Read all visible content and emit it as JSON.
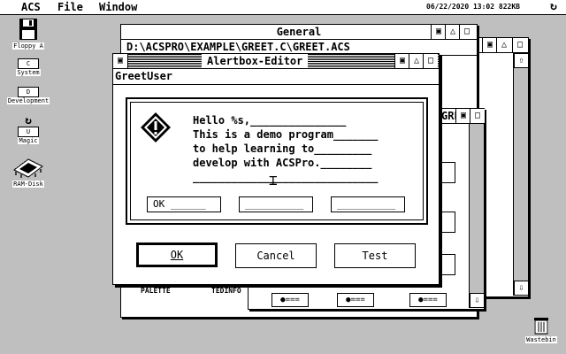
{
  "menubar": {
    "items": [
      "ACS",
      "File",
      "Window"
    ],
    "clock": "06/22/2020 13:02 822KB"
  },
  "desktop": {
    "icons": [
      {
        "name": "floppy-icon",
        "label": "Floppy A"
      },
      {
        "name": "drive-c-icon",
        "label": "System",
        "letter": "C"
      },
      {
        "name": "drive-d-icon",
        "label": "Development",
        "letter": "D"
      },
      {
        "name": "drive-u-icon",
        "label": "Magic",
        "letter": "U"
      },
      {
        "name": "ramdisk-icon",
        "label": "RAM-Disk"
      },
      {
        "name": "trash-icon",
        "label": "Wastebin"
      }
    ]
  },
  "general_window": {
    "title": "General",
    "path": "D:\\ACSPRO\\EXAMPLE\\GREET.C\\GREET.ACS",
    "items": [
      "PALETTE",
      "TEDINFO"
    ]
  },
  "back_window": {
    "title": "GREET."
  },
  "alert_editor": {
    "title": "Alertbox-Editor",
    "name": "GreetUser",
    "lines": [
      "Hello %s,_______________",
      "This is a demo program_______",
      "to help learning to_________",
      "develop with ACSPro.________",
      "_____________________________"
    ],
    "fields": [
      "OK ______",
      "__________",
      "__________"
    ],
    "buttons": {
      "ok": "OK",
      "cancel": "Cancel",
      "test": "Test"
    }
  }
}
